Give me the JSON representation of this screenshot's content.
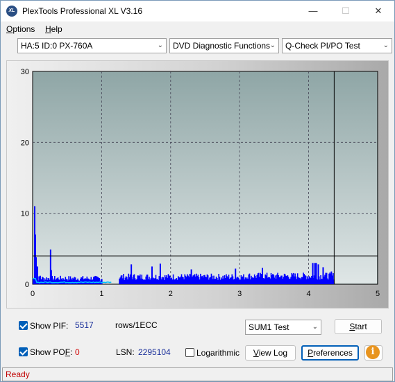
{
  "window": {
    "title": "PlexTools Professional XL V3.16",
    "app_icon_text": "XL",
    "minimize_glyph": "—",
    "maximize_glyph": "☐",
    "close_glyph": "✕"
  },
  "menu": [
    {
      "accel": "O",
      "rest": "ptions"
    },
    {
      "accel": "H",
      "rest": "elp"
    }
  ],
  "toolbar": {
    "drive_select": "HA:5 ID:0  PX-760A",
    "function_select": "DVD Diagnostic Functions",
    "test_select": "Q-Check PI/PO Test",
    "arrow_glyph": "⌄"
  },
  "chart_data": {
    "type": "bar",
    "xlim": [
      0,
      5
    ],
    "ylim": [
      0,
      30
    ],
    "x_ticks": [
      "0",
      "1",
      "2",
      "3",
      "4",
      "5"
    ],
    "y_ticks": [
      "0",
      "10",
      "20",
      "30"
    ],
    "grid": true,
    "threshold_line": 4,
    "end_marker_x": 4.37,
    "plot_background": "#9aadad",
    "bar_color": "#0000ff",
    "secondary_color": "#00c0ff",
    "spikes": [
      {
        "x": 0.02,
        "y": 11
      },
      {
        "x": 0.03,
        "y": 7
      },
      {
        "x": 0.04,
        "y": 3.8
      },
      {
        "x": 0.06,
        "y": 2.5
      },
      {
        "x": 0.1,
        "y": 1.2
      },
      {
        "x": 0.25,
        "y": 4.9
      },
      {
        "x": 0.26,
        "y": 2
      },
      {
        "x": 1.42,
        "y": 2.8
      },
      {
        "x": 1.72,
        "y": 2.5
      },
      {
        "x": 1.84,
        "y": 2.9
      },
      {
        "x": 2.29,
        "y": 2.1
      },
      {
        "x": 2.93,
        "y": 2.2
      },
      {
        "x": 3.32,
        "y": 2.3
      },
      {
        "x": 4.05,
        "y": 3
      },
      {
        "x": 4.08,
        "y": 3
      },
      {
        "x": 4.1,
        "y": 3
      },
      {
        "x": 4.13,
        "y": 2.8
      },
      {
        "x": 4.2,
        "y": 2.4
      },
      {
        "x": 4.25,
        "y": 1.6
      },
      {
        "x": 4.32,
        "y": 1.8
      }
    ],
    "baseline_segments": [
      {
        "from": 0.0,
        "to": 1.0,
        "height": 0.8
      },
      {
        "from": 1.25,
        "to": 3.1,
        "height": 1.0
      },
      {
        "from": 3.1,
        "to": 4.37,
        "height": 1.1
      }
    ]
  },
  "controls": {
    "show_pif_label": "Show PIF:",
    "show_pif_checked": true,
    "pif_value": "5517",
    "pif_unit": "rows/1ECC",
    "show_pof_accel": "F",
    "show_pof_pre": "Show PO",
    "show_pof_post": ":",
    "show_pof_checked": true,
    "pof_value": "0",
    "lsn_label": "LSN:",
    "lsn_value": "2295104",
    "logarithmic_label": "Logarithmic",
    "logarithmic_checked": false,
    "sum_select": "SUM1 Test",
    "start_accel": "S",
    "start_rest": "tart",
    "viewlog_accel": "V",
    "viewlog_rest": "iew Log",
    "preferences_accel": "P",
    "preferences_rest": "references",
    "info_glyph": "i"
  },
  "status": {
    "text": "Ready"
  }
}
